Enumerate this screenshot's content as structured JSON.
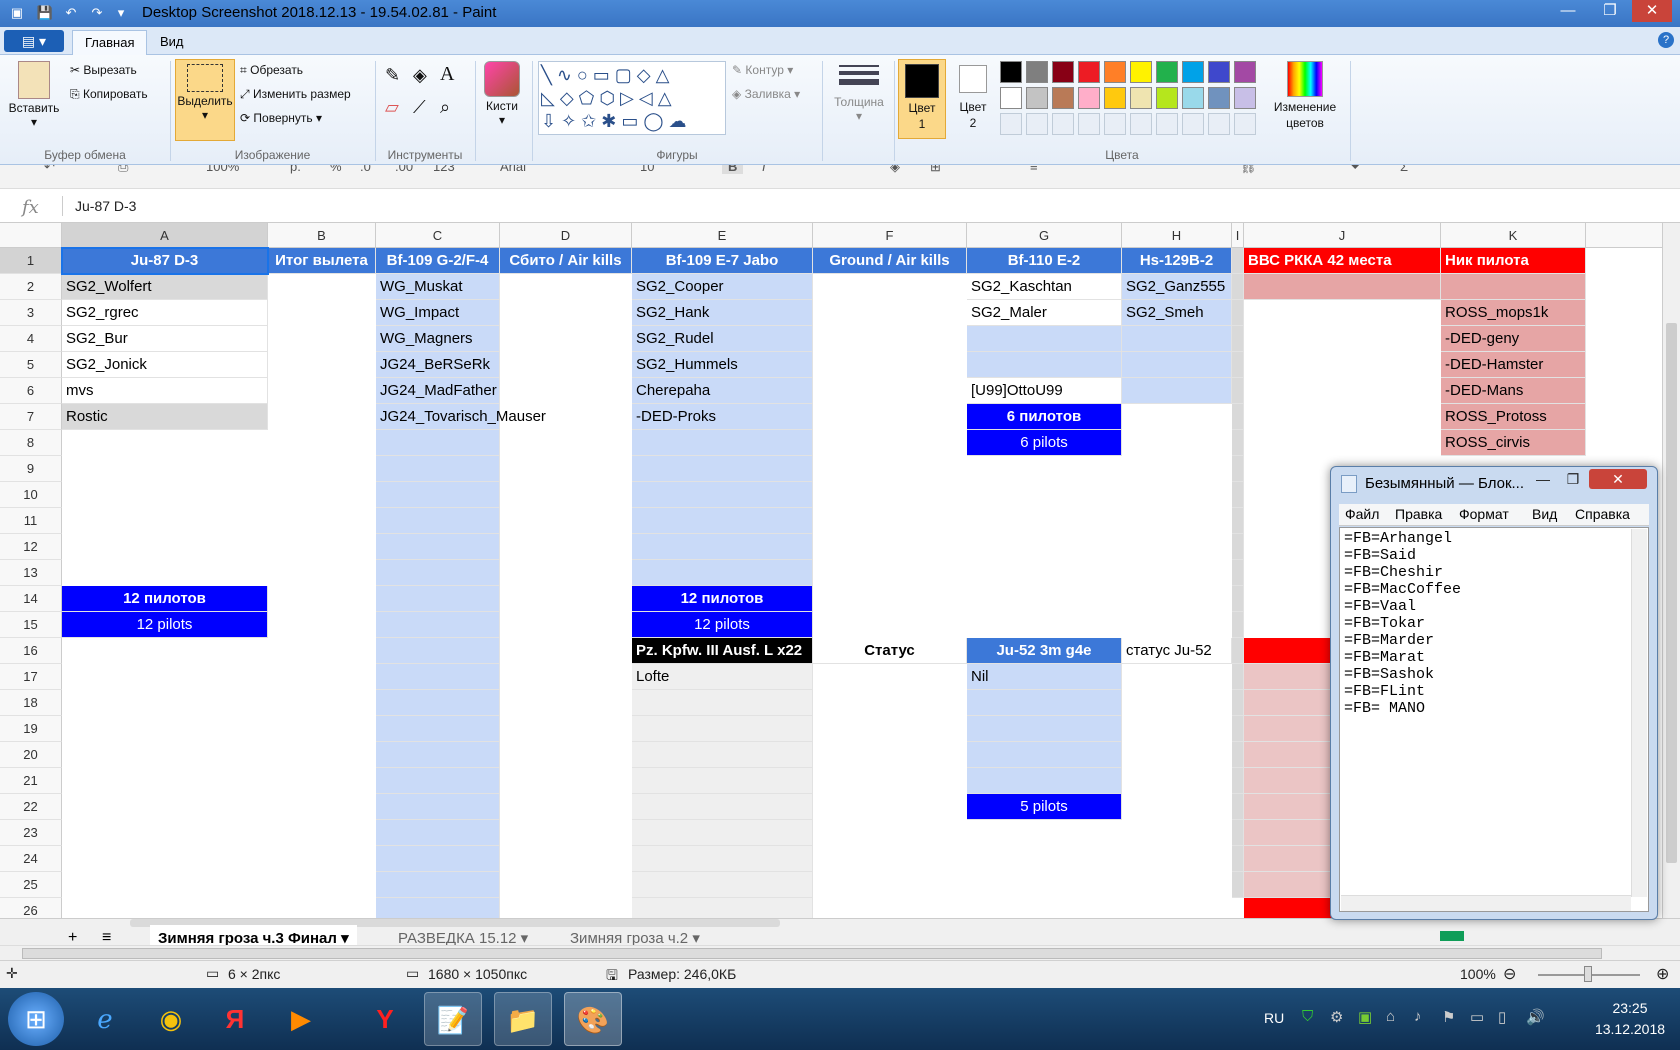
{
  "window": {
    "title": "Desktop Screenshot 2018.12.13 - 19.54.02.81 - Paint"
  },
  "ribbon": {
    "tabs": [
      "Главная",
      "Вид"
    ],
    "clipboard": {
      "paste": "Вставить",
      "cut": "Вырезать",
      "copy": "Копировать",
      "label": "Буфер обмена"
    },
    "image": {
      "select": "Выделить",
      "crop": "Обрезать",
      "resize": "Изменить размер",
      "rotate": "Повернуть",
      "label": "Изображение"
    },
    "tools": {
      "label": "Инструменты"
    },
    "brushes": {
      "label": "Кисти"
    },
    "shapes": {
      "outline": "Контур",
      "fill": "Заливка",
      "label": "Фигуры"
    },
    "size": {
      "label": "Толщина"
    },
    "colors": {
      "color1": "Цвет 1",
      "color2": "Цвет 2",
      "edit": "Изменение цветов",
      "label": "Цвета",
      "palette_row1": [
        "#000000",
        "#7f7f7f",
        "#880015",
        "#ed1c24",
        "#ff7f27",
        "#fff200",
        "#22b14c",
        "#00a2e8",
        "#3f48cc",
        "#a349a4"
      ],
      "palette_row2": [
        "#ffffff",
        "#c3c3c3",
        "#b97a57",
        "#ffaec9",
        "#ffc90e",
        "#efe4b0",
        "#b5e61d",
        "#99d9ea",
        "#7092be",
        "#c8bfe7"
      ]
    }
  },
  "sheet_toolbar": {
    "zoom": "100%",
    "currency": "р.",
    "percent": "%",
    "dec0": ".0",
    "dec00": ".00",
    "fmt": "123",
    "font": "Arial",
    "size": "10"
  },
  "formula": {
    "value": "Ju-87 D-3"
  },
  "columns": [
    "A",
    "B",
    "C",
    "D",
    "E",
    "F",
    "G",
    "H",
    "I",
    "J",
    "K"
  ],
  "rows": [
    "1",
    "2",
    "3",
    "4",
    "5",
    "6",
    "7",
    "8",
    "9",
    "10",
    "11",
    "12",
    "13",
    "14",
    "15",
    "16",
    "17",
    "18",
    "19",
    "20",
    "21",
    "22",
    "23",
    "24",
    "25",
    "26"
  ],
  "headers": {
    "A": "Ju-87 D-3",
    "B": "Итог вылета",
    "C": "Bf-109 G-2/F-4",
    "D": "Сбито / Air kills",
    "E": "Bf-109 E-7 Jabo",
    "F": "Ground / Air kills",
    "G": "Bf-110 E-2",
    "H": "Hs-129B-2",
    "J": "ВВС РККА 42 места",
    "K": "Ник пилота"
  },
  "colA": [
    "SG2_Wolfert",
    "SG2_rgrec",
    "SG2_Bur",
    "SG2_Jonick",
    "mvs",
    "Rostic"
  ],
  "colC": [
    "WG_Muskat",
    "WG_Impact",
    "WG_Magners",
    "JG24_BeRSeRk",
    "JG24_MadFather",
    "JG24_Tovarisch_Mauser"
  ],
  "colE": [
    "SG2_Cooper",
    "SG2_Hank",
    "SG2_Rudel",
    "SG2_Hummels",
    "Cherepaha",
    "-DED-Proks"
  ],
  "colG": [
    "SG2_Kaschtan",
    "SG2_Maler",
    "",
    "",
    "[U99]OttoU99"
  ],
  "colH": [
    "SG2_Ganz555",
    "SG2_Smeh"
  ],
  "colK": [
    "ROSS_mops1k",
    "-DED-geny",
    "-DED-Hamster",
    "-DED-Mans",
    "ROSS_Protoss",
    "ROSS_cirvis"
  ],
  "blocks": {
    "g_ru": "6 пилотов",
    "g_en": "6 pilots",
    "a_ru": "12 пилотов",
    "a_en": "12 pilots",
    "e_ru": "12 пилотов",
    "e_en": "12 pilots",
    "g22": "5 pilots"
  },
  "row16": {
    "E": "Pz. Kpfw. III Ausf. L x22",
    "F": "Статус",
    "G": "Ju-52 3m g4e",
    "H": "статус Ju-52"
  },
  "row17": {
    "E": "Lofte",
    "G": "Nil"
  },
  "sheet_tabs": [
    "Зимняя гроза ч.3 Финал",
    "РАЗВЕДКА 15.12",
    "Зимняя гроза ч.2"
  ],
  "status": {
    "selection": "6 × 2пкс",
    "dims": "1680 × 1050пкс",
    "size": "Размер: 246,0КБ",
    "zoom": "100%"
  },
  "taskbar": {
    "lang": "RU",
    "time": "23:25",
    "date": "13.12.2018"
  },
  "notepad": {
    "title": "Безымянный — Блок...",
    "menu": [
      "Файл",
      "Правка",
      "Формат",
      "Вид",
      "Справка"
    ],
    "text": "=FB=Arhangel\n=FB=Said\n=FB=Cheshir\n=FB=MacCoffee\n=FB=Vaal\n=FB=Tokar\n=FB=Marder\n=FB=Marat\n=FB=Sashok\n=FB=FLint\n=FB= MANO"
  }
}
